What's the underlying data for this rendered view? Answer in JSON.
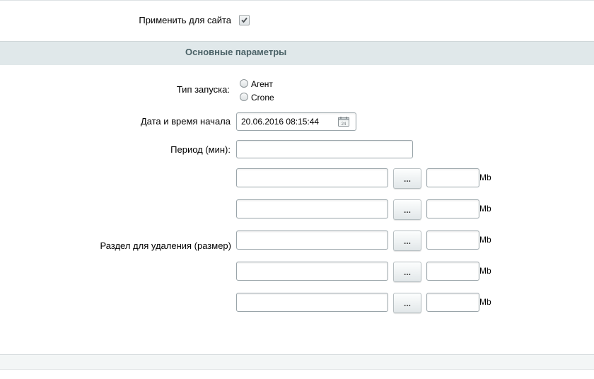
{
  "apply_for_site": {
    "label": "Применить для сайта",
    "checked": true
  },
  "section": {
    "title": "Основные параметры"
  },
  "launch_type": {
    "label": "Тип запуска:",
    "options": [
      "Агент",
      "Crone"
    ]
  },
  "start_datetime": {
    "label": "Дата и время начала",
    "value": "20.06.2016 08:15:44",
    "icon": "calendar-icon"
  },
  "period": {
    "label": "Период (мин):",
    "value": ""
  },
  "delete_section": {
    "label": "Раздел для удаления (размер)",
    "rows": [
      {
        "path": "",
        "browse_label": "...",
        "size": "",
        "unit": "Mb"
      },
      {
        "path": "",
        "browse_label": "...",
        "size": "",
        "unit": "Mb"
      },
      {
        "path": "",
        "browse_label": "...",
        "size": "",
        "unit": "Mb"
      },
      {
        "path": "",
        "browse_label": "...",
        "size": "",
        "unit": "Mb"
      },
      {
        "path": "",
        "browse_label": "...",
        "size": "",
        "unit": "Mb"
      }
    ]
  },
  "colors": {
    "section_bg": "#e0e8ea",
    "section_title": "#4b6267",
    "border": "#9aa5aa"
  }
}
